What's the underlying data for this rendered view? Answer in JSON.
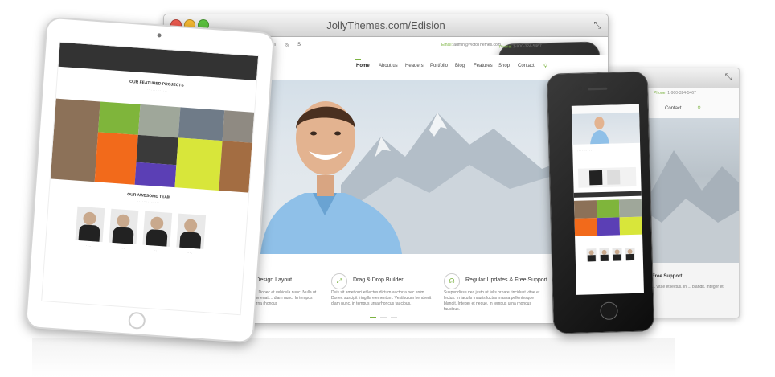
{
  "browser": {
    "title": "JollyThemes.com/Edision",
    "email_label": "Email:",
    "email_value": "admin@VictoThemes.com",
    "phone_label": "Phone:",
    "phone_value": "1-900-324-5467"
  },
  "nav": [
    "Home",
    "About us",
    "Headers",
    "Portfolio",
    "Blog",
    "Features",
    "Shop",
    "Contact"
  ],
  "features": [
    {
      "title": "-Design Layout",
      "text": "... Donec et vehicula nunc. Nulla ut venenat ... diam nunc, In tempus urna rhoncus"
    },
    {
      "title": "Drag & Drop Builder",
      "text": "Duis sit amet orci et lectus dictum auctor a nec enim. Donec suscipit fringilla elementum. Vestibulum hendrerit diam nunc, in tempus urna rhoncus faucibus."
    },
    {
      "title": "Regular Updates & Free Support",
      "text": "Suspendisse nec justo ut felis ornare tincidunt vitae et lectus. In iaculis mauris luctus massa pellentesque blandit. Integer et neque, in tempus urna rhoncus faucibus."
    }
  ],
  "back_window": {
    "phone_label": "Phone:",
    "phone_value": "1-900-324-5467",
    "nav": "Contact",
    "feature_title": "Free Support",
    "feature_text": "... vitae et lectus. In ... blandit. Integer et"
  },
  "tablet": {
    "portfolio_title": "OUR FEATURED PROJECTS",
    "team_title": "OUR AWESOME TEAM"
  },
  "colors": {
    "accent": "#7cb342",
    "orange": "#f26a1b",
    "purple": "#5b3fb5",
    "lime": "#d8e63a",
    "green": "#7fb53b"
  }
}
